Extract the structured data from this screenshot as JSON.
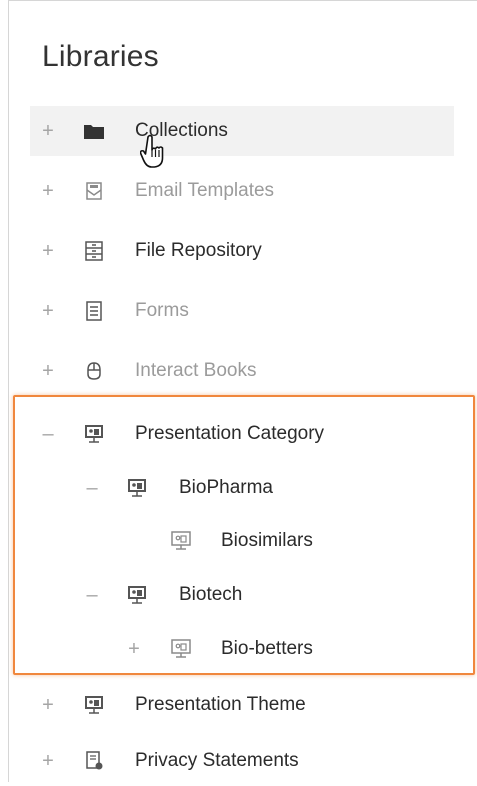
{
  "panel": {
    "title": "Libraries"
  },
  "tree": [
    {
      "label": "Collections",
      "toggle": "+",
      "icon": "folder-icon",
      "muted": false
    },
    {
      "label": "Email Templates",
      "toggle": "+",
      "icon": "email-template-icon",
      "muted": true
    },
    {
      "label": "File Repository",
      "toggle": "+",
      "icon": "file-repository-icon",
      "muted": false
    },
    {
      "label": "Forms",
      "toggle": "+",
      "icon": "forms-icon",
      "muted": true
    },
    {
      "label": "Interact Books",
      "toggle": "+",
      "icon": "interact-books-icon",
      "muted": true
    },
    {
      "label": "Presentation Category",
      "toggle": "–",
      "icon": "presentation-icon",
      "muted": false
    },
    {
      "label": "BioPharma",
      "toggle": "–",
      "icon": "presentation-icon",
      "muted": false
    },
    {
      "label": "Biosimilars",
      "toggle": "",
      "icon": "presentation-outline-icon",
      "muted": false
    },
    {
      "label": "Biotech",
      "toggle": "–",
      "icon": "presentation-icon",
      "muted": false
    },
    {
      "label": "Bio-betters",
      "toggle": "+",
      "icon": "presentation-outline-icon",
      "muted": false
    },
    {
      "label": "Presentation Theme",
      "toggle": "+",
      "icon": "presentation-icon",
      "muted": false
    },
    {
      "label": "Privacy Statements",
      "toggle": "+",
      "icon": "privacy-statement-icon",
      "muted": false
    }
  ],
  "colors": {
    "highlight_border": "#f0873d",
    "hover_background": "#f2f2f2",
    "muted_text": "#9b9b9b",
    "text": "#2b2b2b"
  }
}
